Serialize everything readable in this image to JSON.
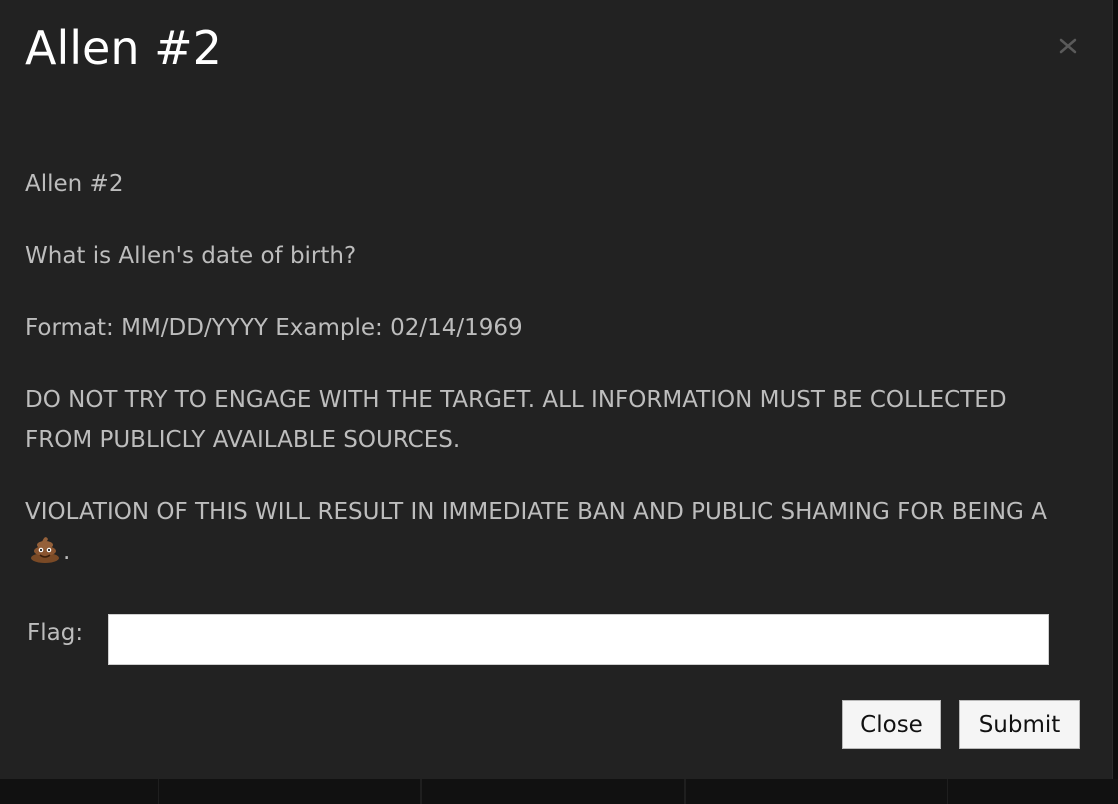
{
  "modal": {
    "title": "Allen #2",
    "paragraphs": {
      "name": "Allen #2",
      "question": "What is Allen's date of birth?",
      "format": "Format: MM/DD/YYYY Example: 02/14/1969",
      "warning": "DO NOT TRY TO ENGAGE WITH THE TARGET. ALL INFORMATION MUST BE COLLECTED FROM PUBLICLY AVAILABLE SOURCES.",
      "violation_prefix": "VIOLATION OF THIS WILL RESULT IN IMMEDIATE BAN AND PUBLIC SHAMING FOR BEING A",
      "violation_suffix": "."
    },
    "violation_icon": "pile-of-poo-icon",
    "flag": {
      "label": "Flag:",
      "value": "",
      "placeholder": ""
    },
    "buttons": {
      "close_label": "Close",
      "submit_label": "Submit"
    },
    "close_icon": "close-icon"
  }
}
